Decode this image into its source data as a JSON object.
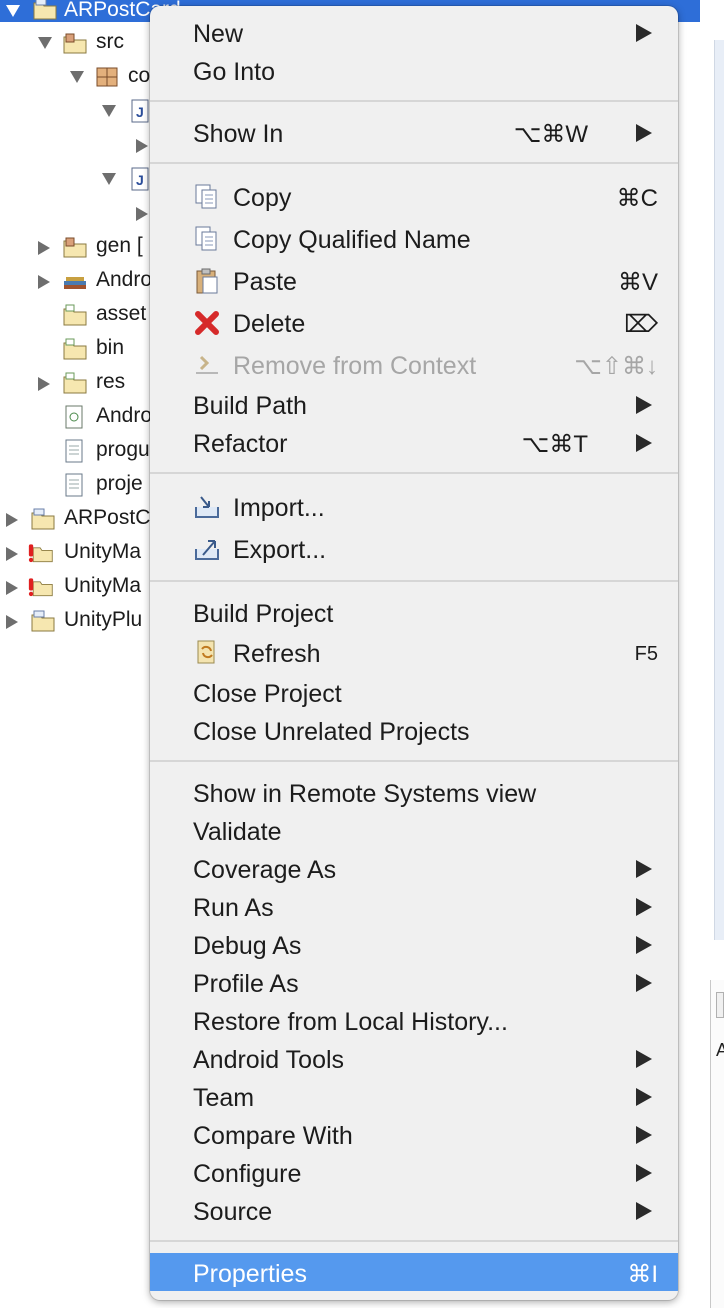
{
  "tree": {
    "rows": [
      {
        "label": "ARPostCard",
        "expanded": true,
        "icon": "project-folder-icon"
      },
      {
        "label": "src",
        "expanded": true,
        "icon": "source-folder-icon"
      },
      {
        "label": "co",
        "expanded": true,
        "icon": "package-icon"
      },
      {
        "label": "",
        "expanded": true,
        "icon": "java-file-icon"
      },
      {
        "label": "",
        "expanded": false,
        "icon": "class-icon"
      },
      {
        "label": "",
        "expanded": true,
        "icon": "java-file-icon"
      },
      {
        "label": "",
        "expanded": false,
        "icon": "class-icon"
      },
      {
        "label": "gen [",
        "expanded": false,
        "icon": "source-folder-icon"
      },
      {
        "label": "Andro",
        "expanded": false,
        "icon": "library-icon"
      },
      {
        "label": "asset",
        "expanded": null,
        "icon": "folder-icon"
      },
      {
        "label": "bin",
        "expanded": null,
        "icon": "folder-icon"
      },
      {
        "label": "res",
        "expanded": false,
        "icon": "folder-icon"
      },
      {
        "label": "Andro",
        "expanded": null,
        "icon": "manifest-file-icon"
      },
      {
        "label": "progu",
        "expanded": null,
        "icon": "text-file-icon"
      },
      {
        "label": "proje",
        "expanded": null,
        "icon": "text-file-icon"
      },
      {
        "label": "ARPostC",
        "expanded": false,
        "icon": "project-folder-icon"
      },
      {
        "label": "UnityMa",
        "expanded": false,
        "icon": "error-project-icon"
      },
      {
        "label": "UnityMa",
        "expanded": false,
        "icon": "error-project-icon"
      },
      {
        "label": "UnityPlu",
        "expanded": false,
        "icon": "project-folder-icon"
      }
    ]
  },
  "right_pane": {
    "label": "A"
  },
  "menu": {
    "new": {
      "label": "New"
    },
    "go_into": {
      "label": "Go Into"
    },
    "show_in": {
      "label": "Show In",
      "shortcut": "⌥⌘W"
    },
    "copy": {
      "label": "Copy",
      "shortcut": "⌘C",
      "icon": "copy-icon"
    },
    "copy_qualified": {
      "label": "Copy Qualified Name",
      "icon": "copy-qualified-name-icon"
    },
    "paste": {
      "label": "Paste",
      "shortcut": "⌘V",
      "icon": "paste-icon"
    },
    "delete": {
      "label": "Delete",
      "shortcut": "⌦",
      "icon": "delete-icon"
    },
    "remove_context": {
      "label": "Remove from Context",
      "shortcut": "⌥⇧⌘↓",
      "icon": "remove-from-context-icon",
      "disabled": true
    },
    "build_path": {
      "label": "Build Path"
    },
    "refactor": {
      "label": "Refactor",
      "shortcut": "⌥⌘T"
    },
    "import": {
      "label": "Import...",
      "icon": "import-icon"
    },
    "export": {
      "label": "Export...",
      "icon": "export-icon"
    },
    "build_project": {
      "label": "Build Project"
    },
    "refresh": {
      "label": "Refresh",
      "shortcut": "F5",
      "icon": "refresh-icon"
    },
    "close_project": {
      "label": "Close Project"
    },
    "close_unrelated": {
      "label": "Close Unrelated Projects"
    },
    "show_remote": {
      "label": "Show in Remote Systems view"
    },
    "validate": {
      "label": "Validate"
    },
    "coverage_as": {
      "label": "Coverage As"
    },
    "run_as": {
      "label": "Run As"
    },
    "debug_as": {
      "label": "Debug As"
    },
    "profile_as": {
      "label": "Profile As"
    },
    "restore_history": {
      "label": "Restore from Local History..."
    },
    "android_tools": {
      "label": "Android Tools"
    },
    "team": {
      "label": "Team"
    },
    "compare_with": {
      "label": "Compare With"
    },
    "configure": {
      "label": "Configure"
    },
    "source": {
      "label": "Source"
    },
    "properties": {
      "label": "Properties",
      "shortcut": "⌘I",
      "highlighted": true
    }
  },
  "colors": {
    "selection": "#2e6ed8",
    "menu_highlight": "#5599ee",
    "menu_background": "#f0f0f0",
    "disabled_text": "#a6a6a6"
  }
}
